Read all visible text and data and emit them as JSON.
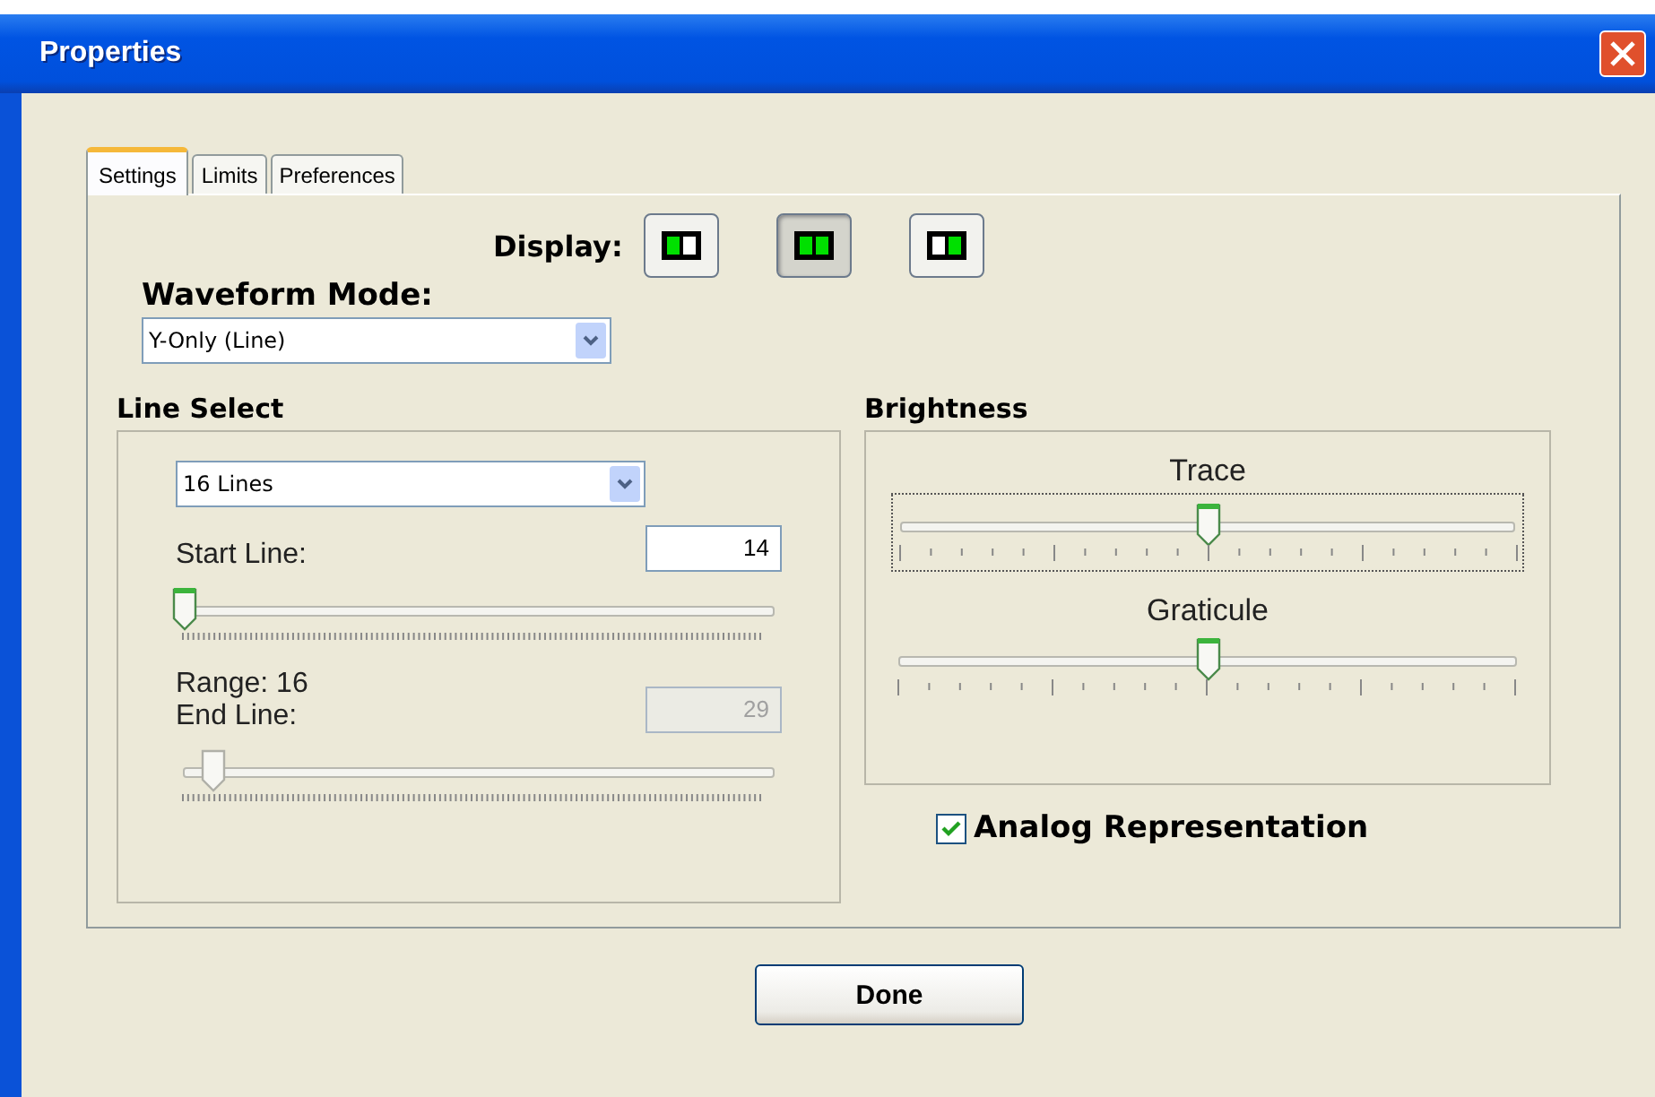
{
  "window": {
    "title": "Properties"
  },
  "tabs": [
    {
      "label": "Settings",
      "selected": true
    },
    {
      "label": "Limits",
      "selected": false
    },
    {
      "label": "Preferences",
      "selected": false
    }
  ],
  "display": {
    "label": "Display:",
    "options": [
      {
        "kind": "left",
        "selected": false
      },
      {
        "kind": "both",
        "selected": true
      },
      {
        "kind": "right",
        "selected": false
      }
    ]
  },
  "waveform_mode": {
    "label": "Waveform Mode:",
    "value": "Y-Only (Line)"
  },
  "line_select": {
    "title": "Line Select",
    "lines": "16 Lines",
    "start": {
      "label": "Start Line:",
      "value": "14",
      "level": 0.0,
      "disabled": false
    },
    "range": "Range:  16",
    "end": {
      "label": "End Line:",
      "value": "29",
      "level": 0.05,
      "disabled": true
    }
  },
  "brightness": {
    "title": "Brightness",
    "sliders": [
      {
        "label": "Trace",
        "level": 0.5,
        "focused": true
      },
      {
        "label": "Graticule",
        "level": 0.5,
        "focused": false
      }
    ]
  },
  "analog": {
    "label": "Analog Representation",
    "checked": true
  },
  "buttons": [
    "Done"
  ]
}
